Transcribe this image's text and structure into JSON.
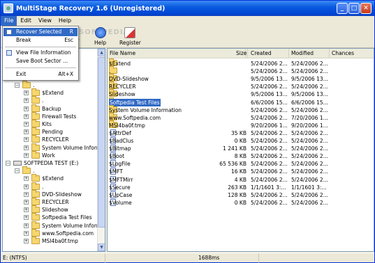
{
  "title": "MultiStage Recovery 1.6  (Unregistered)",
  "menubar": [
    "File",
    "Edit",
    "View",
    "Help"
  ],
  "toolbar": {
    "partial": "gs",
    "help": "Help",
    "register": "Register"
  },
  "watermark": "SOFTPEDIA",
  "file_menu": [
    {
      "label": "Recover Selected",
      "shortcut": "R"
    },
    {
      "label": "Break",
      "shortcut": "Esc"
    },
    {
      "label": "View File Information",
      "shortcut": ""
    },
    {
      "label": "Save Boot Sector ...",
      "shortcut": ""
    },
    {
      "label": "Exit",
      "shortcut": "Alt+X"
    }
  ],
  "tree": {
    "drive1_items": [
      ".",
      "$Extend",
      ".",
      "Backup",
      "Firewall Tests",
      "Kits",
      "Pending",
      "RECYCLER",
      "System Volume Informat",
      "Work"
    ],
    "drive2": "SOFTPEDIA TEST (E:)",
    "drive2_items": [
      ".",
      "$Extend",
      ".",
      "DVD-Slideshow",
      "RECYCLER",
      "Slideshow",
      "Softpedia Test Files",
      "System Volume Informat",
      "www.Softpedia.com",
      "MSI4ba0f.tmp"
    ]
  },
  "columns": {
    "name": "File Name",
    "size": "Size",
    "created": "Created",
    "modified": "Modified",
    "chances": "Chances"
  },
  "files": [
    {
      "name": "$Extend",
      "size": "",
      "created": "5/24/2006 2...",
      "modified": "5/24/2006 2...",
      "type": "folder"
    },
    {
      "name": ".",
      "size": "",
      "created": "5/24/2006 2...",
      "modified": "5/24/2006 2...",
      "type": "folder"
    },
    {
      "name": "DVD-Slideshow",
      "size": "",
      "created": "9/5/2006 13...",
      "modified": "9/5/2006 13...",
      "type": "folder"
    },
    {
      "name": "RECYCLER",
      "size": "",
      "created": "5/24/2006 2...",
      "modified": "5/24/2006 2...",
      "type": "folder"
    },
    {
      "name": "Slideshow",
      "size": "",
      "created": "9/5/2006 13...",
      "modified": "9/5/2006 13...",
      "type": "folder"
    },
    {
      "name": "Softpedia Test Files",
      "size": "",
      "created": "6/6/2006 15...",
      "modified": "6/6/2006 15...",
      "type": "folder-gray",
      "selected": true
    },
    {
      "name": "System Volume Information",
      "size": "",
      "created": "5/24/2006 2...",
      "modified": "5/24/2006 2...",
      "type": "folder"
    },
    {
      "name": "www.Softpedia.com",
      "size": "",
      "created": "5/24/2006 2...",
      "modified": "7/20/2006 1...",
      "type": "folder"
    },
    {
      "name": "MSI4ba0f.tmp",
      "size": "",
      "created": "9/20/2006 1...",
      "modified": "9/20/2006 1...",
      "type": "folder"
    },
    {
      "name": "$AttrDef",
      "size": "35 KB",
      "created": "5/24/2006 2...",
      "modified": "5/24/2006 2...",
      "type": "file"
    },
    {
      "name": "$BadClus",
      "size": "0 KB",
      "created": "5/24/2006 2...",
      "modified": "5/24/2006 2...",
      "type": "file"
    },
    {
      "name": "$Bitmap",
      "size": "1 241 KB",
      "created": "5/24/2006 2...",
      "modified": "5/24/2006 2...",
      "type": "file"
    },
    {
      "name": "$Boot",
      "size": "8 KB",
      "created": "5/24/2006 2...",
      "modified": "5/24/2006 2...",
      "type": "file"
    },
    {
      "name": "$LogFile",
      "size": "65 536 KB",
      "created": "5/24/2006 2...",
      "modified": "5/24/2006 2...",
      "type": "file"
    },
    {
      "name": "$MFT",
      "size": "16 KB",
      "created": "5/24/2006 2...",
      "modified": "5/24/2006 2...",
      "type": "file"
    },
    {
      "name": "$MFTMirr",
      "size": "4 KB",
      "created": "5/24/2006 2...",
      "modified": "5/24/2006 2...",
      "type": "file"
    },
    {
      "name": "$Secure",
      "size": "263 KB",
      "created": "1/1/1601 3:...",
      "modified": "1/1/1601 3:...",
      "type": "file"
    },
    {
      "name": "$UpCase",
      "size": "128 KB",
      "created": "5/24/2006 2...",
      "modified": "5/24/2006 2...",
      "type": "file"
    },
    {
      "name": "$Volume",
      "size": "0 KB",
      "created": "5/24/2006 2...",
      "modified": "5/24/2006 2...",
      "type": "file"
    }
  ],
  "status": {
    "drive": "E: (NTFS)",
    "time": "1688ms"
  }
}
